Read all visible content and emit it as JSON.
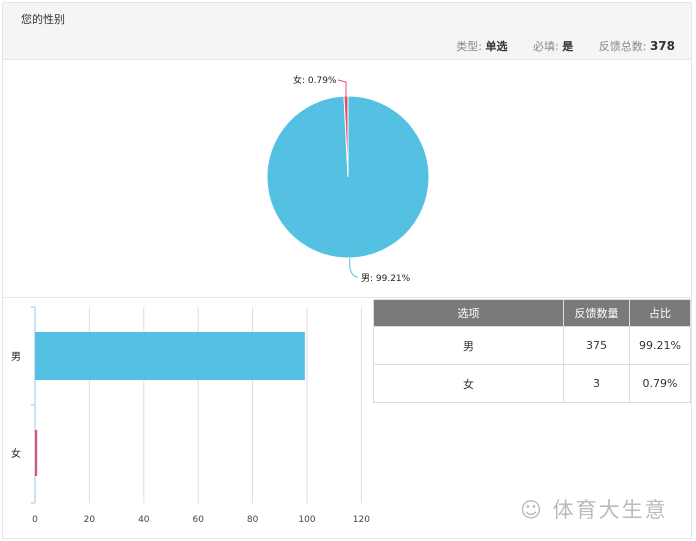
{
  "header": {
    "title": "您的性别",
    "type_label": "类型:",
    "type_value": "单选",
    "required_label": "必填:",
    "required_value": "是",
    "total_label": "反馈总数:",
    "total_value": "378"
  },
  "colors": {
    "male": "#54c1e3",
    "female": "#e0506e"
  },
  "chart_data": [
    {
      "type": "pie",
      "slices": [
        {
          "label": "男",
          "value": 99.21,
          "text": "男: 99.21%"
        },
        {
          "label": "女",
          "value": 0.79,
          "text": "女: 0.79%"
        }
      ]
    },
    {
      "type": "bar",
      "orientation": "horizontal",
      "categories": [
        "男",
        "女"
      ],
      "values": [
        99.21,
        0.79
      ],
      "xlim": [
        0,
        120
      ],
      "xticks": [
        "0",
        "20",
        "40",
        "60",
        "80",
        "100",
        "120"
      ],
      "grid": true
    }
  ],
  "table": {
    "headers": [
      "选项",
      "反馈数量",
      "占比"
    ],
    "rows": [
      [
        "男",
        "375",
        "99.21%"
      ],
      [
        "女",
        "3",
        "0.79%"
      ]
    ]
  },
  "watermark": "体育大生意"
}
